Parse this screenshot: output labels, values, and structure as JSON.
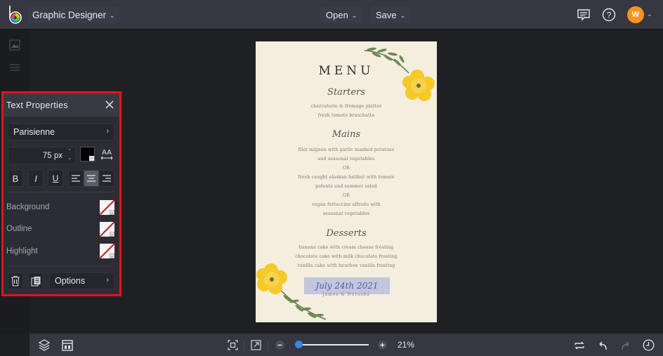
{
  "topbar": {
    "app_name": "Graphic Designer",
    "menus": [
      {
        "label": "Open"
      },
      {
        "label": "Save"
      }
    ],
    "avatar_initial": "W",
    "avatar_color": "#f7941d"
  },
  "panel": {
    "title": "Text Properties",
    "font_family": "Parisienne",
    "font_size": "75 px",
    "text_color": "#000000",
    "format_buttons": [
      "B",
      "I",
      "U"
    ],
    "alignment_active": "center",
    "properties": [
      {
        "label": "Background",
        "value": "none"
      },
      {
        "label": "Outline",
        "value": "none"
      },
      {
        "label": "Highlight",
        "value": "none"
      }
    ],
    "options_label": "Options",
    "border_color": "#e2141a"
  },
  "document": {
    "title": "MENU",
    "sections": [
      {
        "heading": "Starters",
        "items": [
          "charcuterie & fromage platter",
          "fresh tomato bruschatta"
        ]
      },
      {
        "heading": "Mains",
        "items": [
          "filet mignon with garlic mashed potatoes",
          "and seasonal vegetables",
          "OR",
          "fresh caught alaskan halibut with tomato",
          "polenta and summer salad",
          "OR",
          "vegan fettuccine alfredo with",
          "seasonal vegetables"
        ]
      },
      {
        "heading": "Desserts",
        "items": [
          "banana cake with cream cheese frosting",
          "chocolate cake with milk chocolate frosting",
          "vanilla cake with bourbon vanilla frosting"
        ]
      }
    ],
    "date": "July 24th 2021",
    "names": "James & Natasha"
  },
  "bottombar": {
    "zoom_percent": "21%",
    "zoom_value": 21
  }
}
